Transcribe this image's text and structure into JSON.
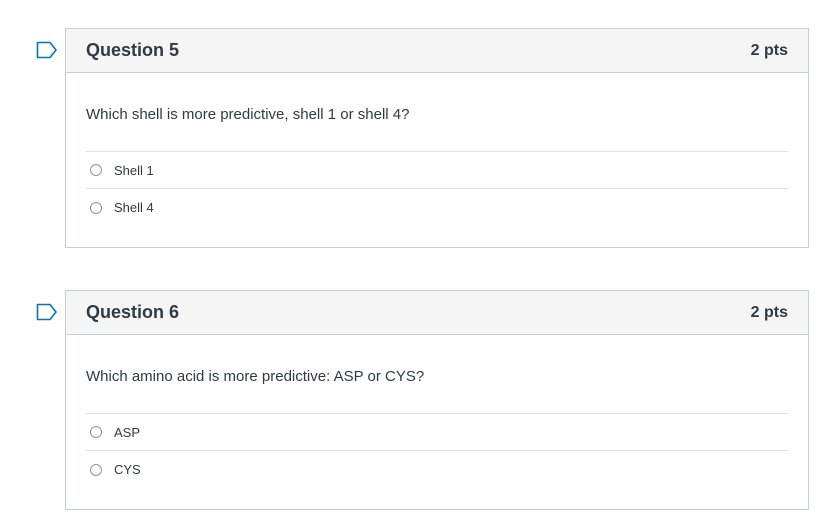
{
  "questions": [
    {
      "title": "Question 5",
      "points": "2 pts",
      "text": "Which shell is more predictive, shell 1 or shell 4?",
      "answers": [
        "Shell 1",
        "Shell 4"
      ]
    },
    {
      "title": "Question 6",
      "points": "2 pts",
      "text": "Which amino acid is more predictive: ASP or CYS?",
      "answers": [
        "ASP",
        "CYS"
      ]
    }
  ],
  "colors": {
    "border": "#c7cdd1",
    "header_bg": "#f5f5f5",
    "text": "#2d3b45",
    "flag_stroke": "#0374b5"
  },
  "icons": {
    "flag": "flag-question-icon",
    "radio": "radio-unselected"
  }
}
